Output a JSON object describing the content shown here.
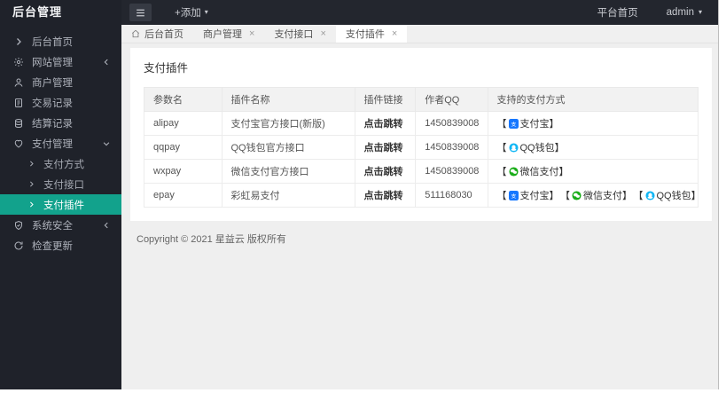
{
  "topbar": {
    "title": "后台管理",
    "add_label": "+添加",
    "platform_home_label": "平台首页",
    "username": "admin"
  },
  "tabs": [
    {
      "label": "后台首页",
      "icon": "home-icon",
      "closable": false,
      "active": false
    },
    {
      "label": "商户管理",
      "closable": true,
      "active": false
    },
    {
      "label": "支付接口",
      "closable": true,
      "active": false
    },
    {
      "label": "支付插件",
      "closable": true,
      "active": true
    }
  ],
  "sidebar": {
    "items": [
      {
        "label": "后台首页",
        "icon": "chevron-right-icon"
      },
      {
        "label": "网站管理",
        "icon": "gear-icon",
        "arrow": "collapsed"
      },
      {
        "label": "商户管理",
        "icon": "user-icon"
      },
      {
        "label": "交易记录",
        "icon": "file-icon"
      },
      {
        "label": "结算记录",
        "icon": "coins-icon"
      },
      {
        "label": "支付管理",
        "icon": "heart-icon",
        "arrow": "expanded",
        "children": [
          {
            "label": "支付方式",
            "active": false
          },
          {
            "label": "支付接口",
            "active": false
          },
          {
            "label": "支付插件",
            "active": true
          }
        ]
      },
      {
        "label": "系统安全",
        "icon": "shield-check-icon",
        "arrow": "collapsed"
      },
      {
        "label": "检查更新",
        "icon": "refresh-icon"
      }
    ]
  },
  "panel": {
    "title": "支付插件"
  },
  "table": {
    "headers": [
      "参数名",
      "插件名称",
      "插件链接",
      "作者QQ",
      "支持的支付方式"
    ],
    "rows": [
      {
        "param": "alipay",
        "plugin_name": "支付宝官方接口(新版)",
        "link_label": "点击跳转",
        "author_qq": "1450839008",
        "methods": [
          {
            "icon": "alipay-icon",
            "label": "支付宝"
          }
        ]
      },
      {
        "param": "qqpay",
        "plugin_name": "QQ钱包官方接口",
        "link_label": "点击跳转",
        "author_qq": "1450839008",
        "methods": [
          {
            "icon": "qq-icon",
            "label": "QQ钱包"
          }
        ]
      },
      {
        "param": "wxpay",
        "plugin_name": "微信支付官方接口",
        "link_label": "点击跳转",
        "author_qq": "1450839008",
        "methods": [
          {
            "icon": "wechat-icon",
            "label": "微信支付"
          }
        ]
      },
      {
        "param": "epay",
        "plugin_name": "彩虹易支付",
        "link_label": "点击跳转",
        "author_qq": "511168030",
        "methods": [
          {
            "icon": "alipay-icon",
            "label": "支付宝"
          },
          {
            "icon": "wechat-icon",
            "label": "微信支付"
          },
          {
            "icon": "qq-icon",
            "label": "QQ钱包"
          }
        ]
      }
    ]
  },
  "footer": {
    "copyright": "Copyright © 2021 星益云 版权所有"
  },
  "colors": {
    "accent_teal": "#12A28C",
    "topbar_bg": "#23262E",
    "sidebar_bg": "#1F222A",
    "content_bg": "#EFEFEF",
    "alipay_blue": "#1677FF",
    "wechat_green": "#1AAD19",
    "qq_blue": "#12B7F5"
  }
}
